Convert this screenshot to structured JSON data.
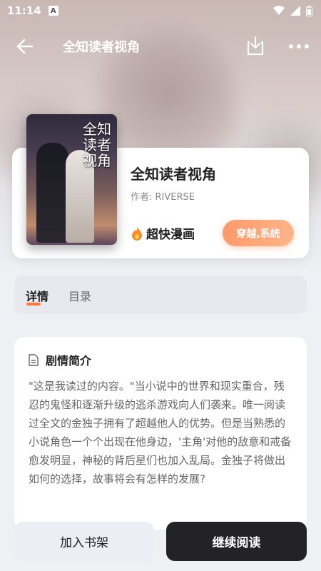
{
  "status": {
    "time": "11:14",
    "notification_badge": "A"
  },
  "header": {
    "title": "全知读者视角"
  },
  "book": {
    "cover_title": "全知读者视角",
    "title": "全知读者视角",
    "author": "作者: RIVERSE",
    "source": "超快漫画",
    "tag": "穿越,系统"
  },
  "tabs": [
    {
      "label": "详情",
      "active": true
    },
    {
      "label": "目录",
      "active": false
    }
  ],
  "synopsis": {
    "heading": "剧情简介",
    "text": "\"这是我读过的内容。\"当小说中的世界和现实重合，残忍的鬼怪和逐渐升级的逃杀游戏向人们袭来。唯一阅读过全文的金独子拥有了超越他人的优势。但是当熟悉的小说角色一个个出现在他身边，'主角'对他的敌意和戒备愈发明显，神秘的背后星们也加入乱局。金独子将做出如何的选择，故事将会有怎样的发展?"
  },
  "actions": {
    "add_shelf": "加入书架",
    "continue_reading": "继续阅读"
  },
  "colors": {
    "accent": "#ff7a3a",
    "primary_button": "#232326",
    "tag_gradient_start": "#ff9a6a"
  },
  "icons": [
    "back-arrow-icon",
    "download-icon",
    "more-icon",
    "fire-icon",
    "document-icon",
    "wifi-icon",
    "signal-icon",
    "battery-icon"
  ]
}
